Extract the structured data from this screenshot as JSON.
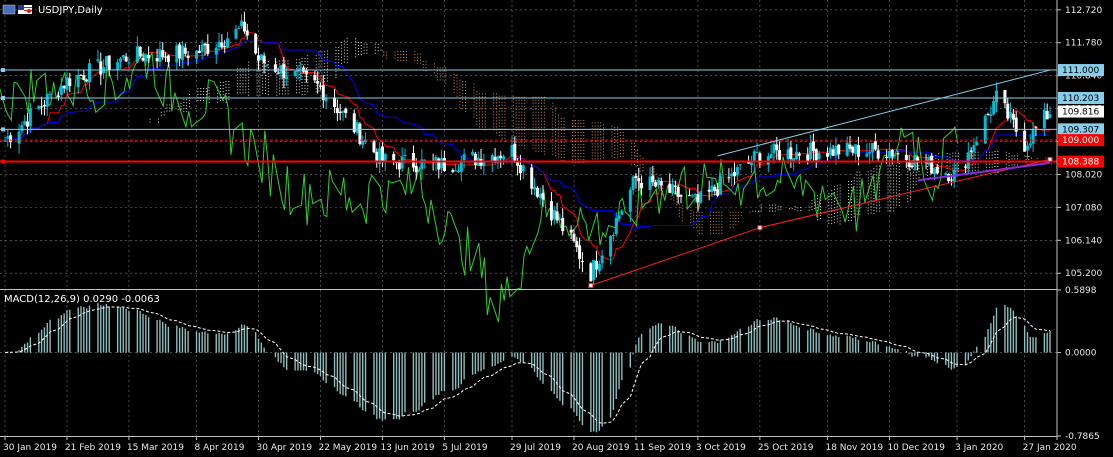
{
  "window": {
    "symbol_title": "USDJPY,Daily"
  },
  "macd": {
    "title": "MACD(12,26,9) 0.0290 -0.0063",
    "ticks": [
      "0.5898",
      "0.0000",
      "-0.7865"
    ]
  },
  "price_axis": {
    "ticks": [
      "112.720",
      "111.780",
      "110.840",
      "109.900",
      "108.960",
      "108.020",
      "107.080",
      "106.140",
      "105.200"
    ]
  },
  "price_tags": [
    {
      "label": "111.000",
      "color": "#87ceeb",
      "text_color": "#000000"
    },
    {
      "label": "110.203",
      "color": "#87ceeb",
      "text_color": "#000000"
    },
    {
      "label": "109.816",
      "color": "#ffffff",
      "text_color": "#000000"
    },
    {
      "label": "109.307",
      "color": "#87ceeb",
      "text_color": "#000000"
    },
    {
      "label": "109.000",
      "color": "#ff0000",
      "text_color": "#ffffff"
    },
    {
      "label": "108.388",
      "color": "#ff0000",
      "text_color": "#ffffff"
    }
  ],
  "time_axis": {
    "ticks": [
      "30 Jan 2019",
      "21 Feb 2019",
      "15 Mar 2019",
      "8 Apr 2019",
      "30 Apr 2019",
      "22 May 2019",
      "13 Jun 2019",
      "5 Jul 2019",
      "29 Jul 2019",
      "20 Aug 2019",
      "11 Sep 2019",
      "3 Oct 2019",
      "25 Oct 2019",
      "18 Nov 2019",
      "10 Dec 2019",
      "3 Jan 2020",
      "27 Jan 2020"
    ]
  },
  "colors": {
    "background": "#000000",
    "bull": "#00bcd4",
    "bear": "#ffffff",
    "tenkan": "#ff0000",
    "kijun": "#0000ff",
    "chikou": "#32cd32",
    "cloud_a": "#ffffff",
    "cloud_b": "#f4a460",
    "trendline": "#ff2020",
    "channel": "#87ceeb",
    "macd_hist": "#8fbcbc",
    "macd_signal": "#ffffff"
  },
  "chart_data": {
    "type": "candlestick",
    "symbol": "USDJPY",
    "timeframe": "Daily",
    "ylim": [
      104.75,
      113.0
    ],
    "x_range": [
      "30 Jan 2019",
      "5 Feb 2020"
    ],
    "price_anchors": [
      {
        "date": "30 Jan 2019",
        "close": 109.0
      },
      {
        "date": "21 Feb 2019",
        "close": 110.7
      },
      {
        "date": "15 Mar 2019",
        "close": 111.4
      },
      {
        "date": "8 Apr 2019",
        "close": 111.5
      },
      {
        "date": "25 Apr 2019",
        "close": 112.2
      },
      {
        "date": "30 Apr 2019",
        "close": 111.3
      },
      {
        "date": "22 May 2019",
        "close": 110.5
      },
      {
        "date": "13 Jun 2019",
        "close": 108.4
      },
      {
        "date": "5 Jul 2019",
        "close": 108.3
      },
      {
        "date": "29 Jul 2019",
        "close": 108.7
      },
      {
        "date": "20 Aug 2019",
        "close": 106.0
      },
      {
        "date": "26 Aug 2019",
        "close": 105.2
      },
      {
        "date": "11 Sep 2019",
        "close": 107.9
      },
      {
        "date": "3 Oct 2019",
        "close": 107.2
      },
      {
        "date": "25 Oct 2019",
        "close": 108.6
      },
      {
        "date": "18 Nov 2019",
        "close": 108.7
      },
      {
        "date": "10 Dec 2019",
        "close": 108.7
      },
      {
        "date": "3 Jan 2020",
        "close": 108.0
      },
      {
        "date": "17 Jan 2020",
        "close": 110.2
      },
      {
        "date": "27 Jan 2020",
        "close": 108.9
      },
      {
        "date": "5 Feb 2020",
        "close": 109.82
      }
    ],
    "horizontal_levels": [
      111.0,
      110.203,
      109.816,
      109.307,
      109.0,
      108.388
    ],
    "trendline": [
      {
        "date": "26 Aug 2019",
        "price": 104.85
      },
      {
        "date": "25 Oct 2019",
        "price": 106.5
      },
      {
        "date": "5 Feb 2020",
        "price": 108.45
      }
    ],
    "channel_line": [
      {
        "date": "10 Oct 2019",
        "price": 108.55
      },
      {
        "date": "5 Feb 2020",
        "price": 111.0
      }
    ],
    "macd": {
      "params": [
        12,
        26,
        9
      ],
      "value": 0.029,
      "signal": -0.0063,
      "ylim": [
        -0.7865,
        0.5898
      ]
    }
  }
}
